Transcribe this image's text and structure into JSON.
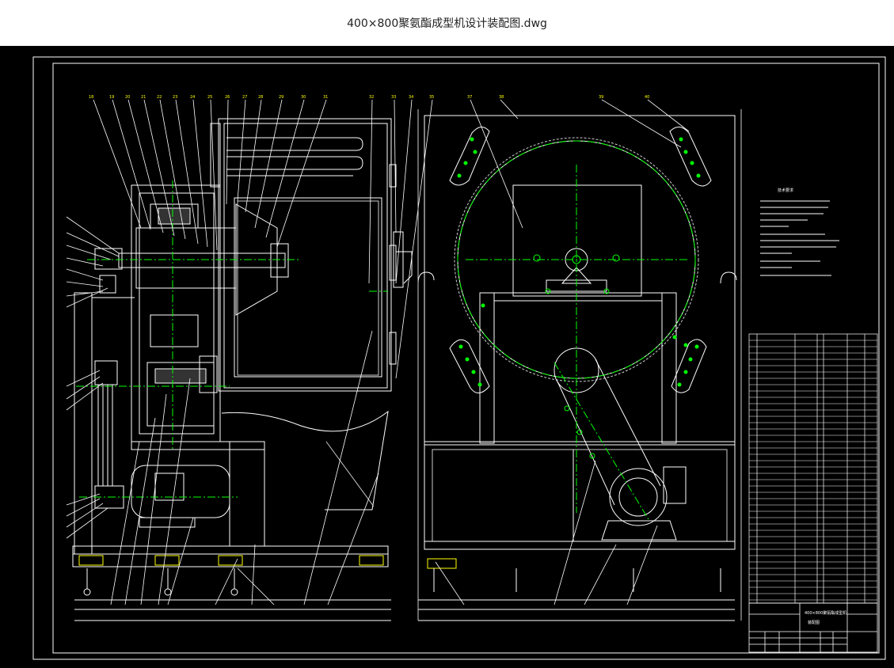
{
  "window": {
    "title": "400×800聚氨酯成型机设计装配图.dwg"
  },
  "drawing": {
    "colors": {
      "background": "#000000",
      "line": "#ffffff",
      "centerline": "#00ff00",
      "accent": "#ffff00",
      "hatch": "#cccccc"
    },
    "tech_requirements_title": "技术要求",
    "title_block_name": "400×800聚氨酯成型机",
    "title_block_sub": "装配图"
  }
}
